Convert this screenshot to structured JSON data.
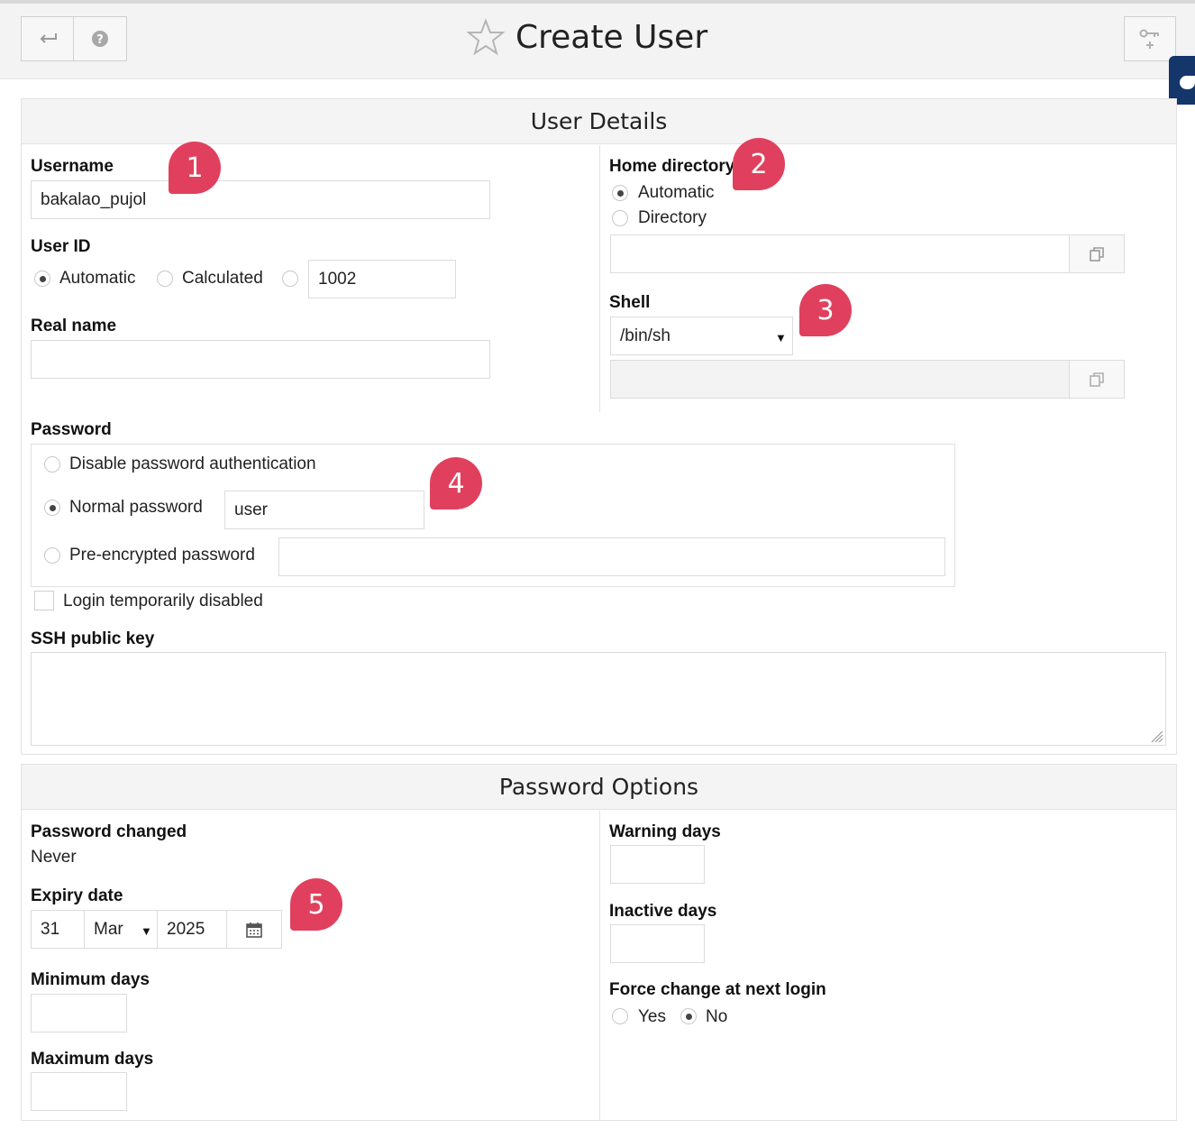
{
  "header": {
    "title": "Create User",
    "back_icon": "return-arrow-icon",
    "help_icon": "question-circle-icon",
    "filter_icon": "key-filter-icon"
  },
  "user_details": {
    "heading": "User Details",
    "username": {
      "label": "Username",
      "value": "bakalao_pujol"
    },
    "user_id": {
      "label": "User ID",
      "options": [
        "Automatic",
        "Calculated"
      ],
      "selected": "Automatic",
      "value": "1002"
    },
    "real_name": {
      "label": "Real name",
      "value": ""
    },
    "home_directory": {
      "label": "Home directory",
      "options": [
        "Automatic",
        "Directory"
      ],
      "selected": "Automatic",
      "value": ""
    },
    "shell": {
      "label": "Shell",
      "selected": "/bin/sh",
      "custom_value": ""
    },
    "password": {
      "label": "Password",
      "options": {
        "disable": "Disable password authentication",
        "normal": "Normal password",
        "pre_encrypted": "Pre-encrypted password"
      },
      "selected": "normal",
      "normal_value": "user",
      "pre_encrypted_value": ""
    },
    "login_disabled": {
      "label": "Login temporarily disabled",
      "checked": false
    },
    "ssh_key": {
      "label": "SSH public key",
      "value": ""
    }
  },
  "password_options": {
    "heading": "Password Options",
    "password_changed": {
      "label": "Password changed",
      "value": "Never"
    },
    "expiry_date": {
      "label": "Expiry date",
      "day": "31",
      "month": "Mar",
      "year": "2025"
    },
    "minimum_days": {
      "label": "Minimum days",
      "value": ""
    },
    "maximum_days": {
      "label": "Maximum days",
      "value": ""
    },
    "warning_days": {
      "label": "Warning days",
      "value": ""
    },
    "inactive_days": {
      "label": "Inactive days",
      "value": ""
    },
    "force_change": {
      "label": "Force change at next login",
      "options": [
        "Yes",
        "No"
      ],
      "selected": "No"
    }
  },
  "annotations": [
    "1",
    "2",
    "3",
    "4",
    "5"
  ],
  "colors": {
    "badge": "#e0405e",
    "side_tab": "#14366b",
    "header_bg": "#f3f3f3"
  }
}
